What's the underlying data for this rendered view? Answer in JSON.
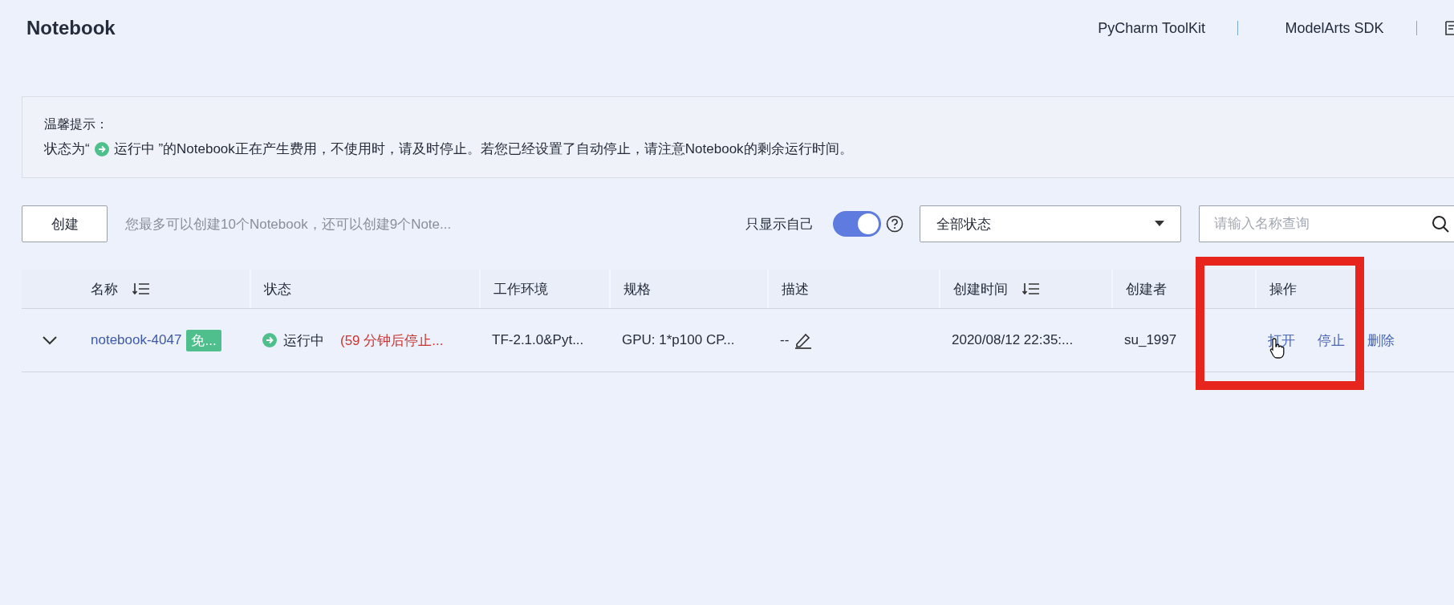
{
  "title": "Notebook",
  "top_links": [
    "PyCharm ToolKit",
    "ModelArts SDK"
  ],
  "notice": {
    "title": "温馨提示：",
    "before": "状态为“",
    "status": "运行中",
    "after": "”的Notebook正在产生费用，不使用时，请及时停止。若您已经设置了自动停止，请注意Notebook的剩余运行时间。"
  },
  "toolbar": {
    "create_button": "创建",
    "hint": "您最多可以创建10个Notebook，还可以创建9个Note...",
    "own_only": {
      "label": "只显示自己",
      "on": true
    },
    "status_filter": "全部状态",
    "search": {
      "placeholder": "请输入名称查询"
    }
  },
  "table": {
    "columns": [
      {
        "label": "名称",
        "sortable": true
      },
      {
        "label": "状态",
        "sortable": false
      },
      {
        "label": "工作环境",
        "sortable": false
      },
      {
        "label": "规格",
        "sortable": false
      },
      {
        "label": "描述",
        "sortable": false
      },
      {
        "label": "创建时间",
        "sortable": true
      },
      {
        "label": "创建者",
        "sortable": false
      },
      {
        "label": "操作",
        "sortable": false
      }
    ],
    "rows": [
      {
        "expanded": false,
        "name": "notebook-4047",
        "tag": "免...",
        "status": "运行中",
        "countdown": "(59 分钟后停止...",
        "environment": "TF-2.1.0&Pyt...",
        "spec": "GPU: 1*p100 CP...",
        "description": "--",
        "created": "2020/08/12 22:35:...",
        "creator": "su_1997",
        "actions": [
          "打开",
          "停止",
          "删除"
        ]
      }
    ]
  }
}
